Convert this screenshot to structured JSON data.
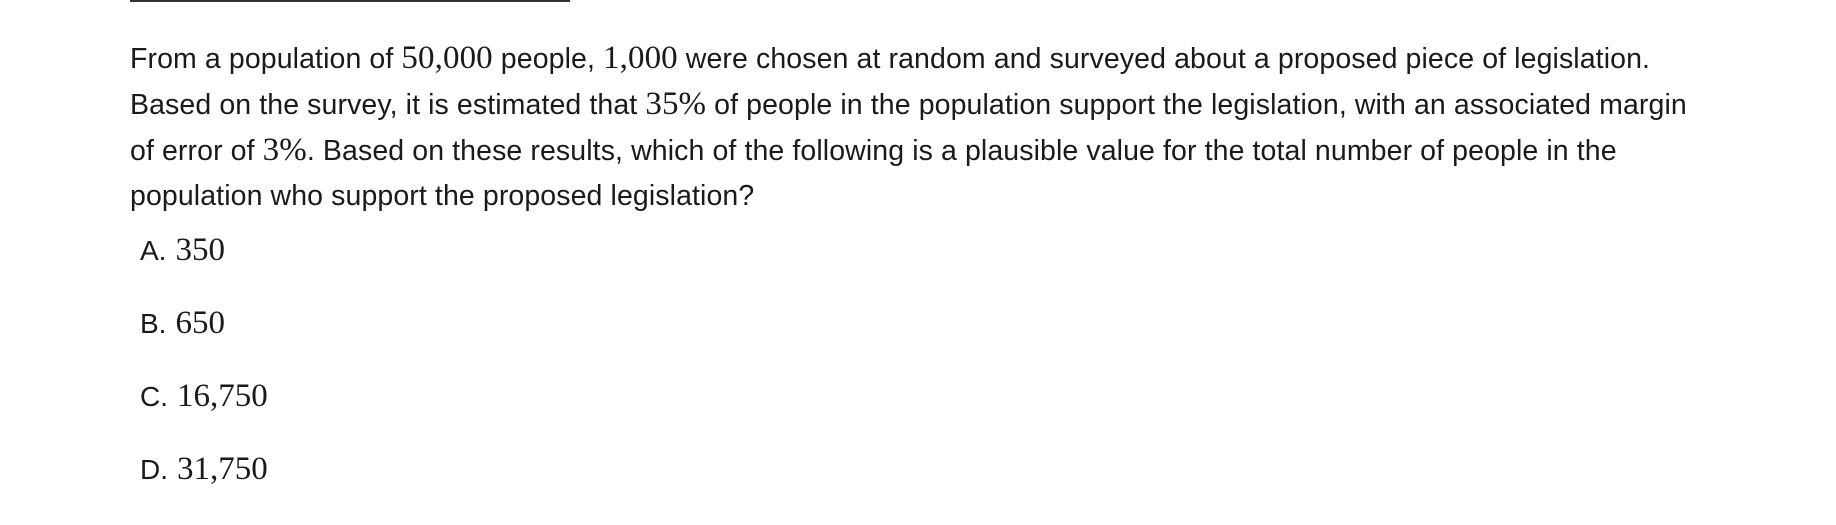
{
  "question": {
    "seg1": "From a population of ",
    "population": "50,000",
    "seg2": " people, ",
    "sample": "1,000",
    "seg3": " were chosen at random and surveyed about a proposed piece of legislation. Based on the survey, it is estimated that ",
    "estimate": "35%",
    "seg4": " of people in the population support the legislation, with an associated margin of error of ",
    "margin": "3%",
    "seg5": ". Based on these results, which of the following is a plausible value for the total number of people in the population who support the proposed legislation?"
  },
  "choices": [
    {
      "letter": "A.",
      "value": "350"
    },
    {
      "letter": "B.",
      "value": "650"
    },
    {
      "letter": "C.",
      "value": "16,750"
    },
    {
      "letter": "D.",
      "value": "31,750"
    }
  ]
}
